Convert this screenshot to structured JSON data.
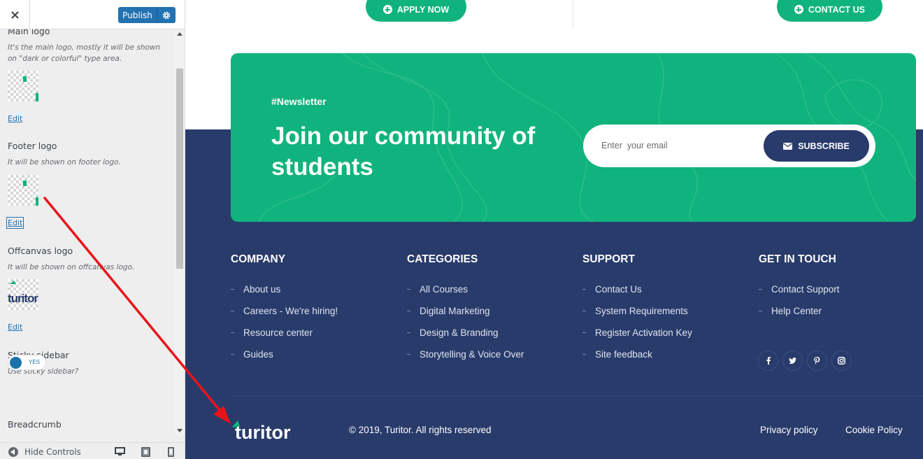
{
  "customizer": {
    "publish_label": "Publish",
    "controls": {
      "main_logo": {
        "title": "Main logo",
        "description": "It's the main logo, mostly it will be shown on \"dark or colorful\" type area.",
        "edit_label": "Edit"
      },
      "footer_logo": {
        "title": "Footer logo",
        "description": "It will be shown on footer logo.",
        "edit_label": "Edit"
      },
      "offcanvas_logo": {
        "title": "Offcanvas logo",
        "description": "It will be shown on offcanvas logo.",
        "edit_label": "Edit"
      },
      "sticky_sidebar": {
        "title": "Sticky sidebar",
        "description": "Use sticky sidebar?",
        "toggle_label": "YES",
        "enabled": true
      },
      "breadcrumb": {
        "title": "Breadcrumb"
      }
    },
    "footer": {
      "hide_controls_label": "Hide Controls",
      "devices": [
        "desktop-icon",
        "tablet-icon",
        "mobile-icon"
      ]
    }
  },
  "preview": {
    "cta_buttons": {
      "apply": "APPLY NOW",
      "contact": "CONTACT US"
    },
    "newsletter": {
      "tag": "#Newsletter",
      "title": "Join our community of students",
      "email_placeholder": "Enter  your email",
      "subscribe_label": "SUBSCRIBE"
    },
    "columns": [
      {
        "title": "COMPANY",
        "links": [
          "About us",
          "Careers - We're hiring!",
          "Resource center",
          "Guides"
        ]
      },
      {
        "title": "CATEGORIES",
        "links": [
          "All Courses",
          "Digital Marketing",
          "Design & Branding",
          "Storytelling & Voice Over"
        ]
      },
      {
        "title": "SUPPORT",
        "links": [
          "Contact Us",
          "System Requirements",
          "Register Activation Key",
          "Site feedback"
        ]
      },
      {
        "title": "GET IN TOUCH",
        "links": [
          "Contact Support",
          "Help Center"
        ]
      }
    ],
    "socials": [
      "facebook-icon",
      "twitter-icon",
      "pinterest-icon",
      "instagram-icon"
    ],
    "brand": "turitor",
    "copyright": "© 2019, Turitor. All rights reserved",
    "legal_links": {
      "privacy": "Privacy policy",
      "cookie": "Cookie Policy"
    }
  },
  "colors": {
    "brand_green": "#10b37d",
    "navy": "#283b6b",
    "wp_blue": "#2271b1",
    "annotation_red": "#e8141a"
  }
}
